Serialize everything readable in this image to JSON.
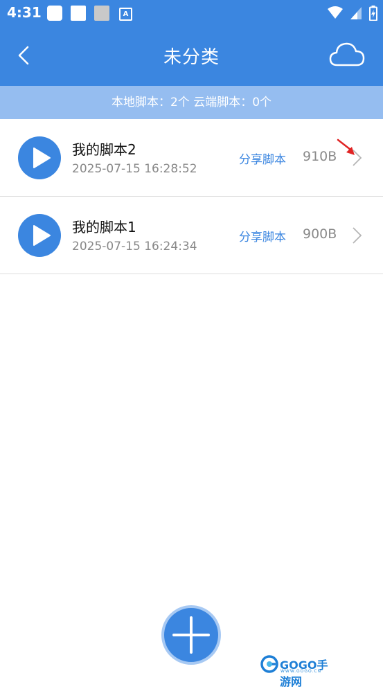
{
  "status_bar": {
    "time": "4:31",
    "notification_icons": [
      "app-icon",
      "app-icon",
      "app-icon",
      "text-icon"
    ],
    "system_icons": [
      "wifi-icon",
      "signal-icon",
      "battery-charging-icon"
    ]
  },
  "header": {
    "back_icon": "chevron-left-icon",
    "title": "未分类",
    "cloud_icon": "cloud-icon",
    "color": "#3b86e0"
  },
  "summary": {
    "text": "本地脚本：2个 云端脚本：0个",
    "background": "#95bdf0"
  },
  "scripts": [
    {
      "name": "我的脚本2",
      "timestamp": "2025-07-15 16:28:52",
      "share_label": "分享脚本",
      "size": "910B"
    },
    {
      "name": "我的脚本1",
      "timestamp": "2025-07-15 16:24:34",
      "share_label": "分享脚本",
      "size": "900B"
    }
  ],
  "fab": {
    "icon": "plus-icon"
  },
  "watermark": {
    "brand": "GOGO手游网",
    "url": "WWW.GOGO.CN"
  }
}
